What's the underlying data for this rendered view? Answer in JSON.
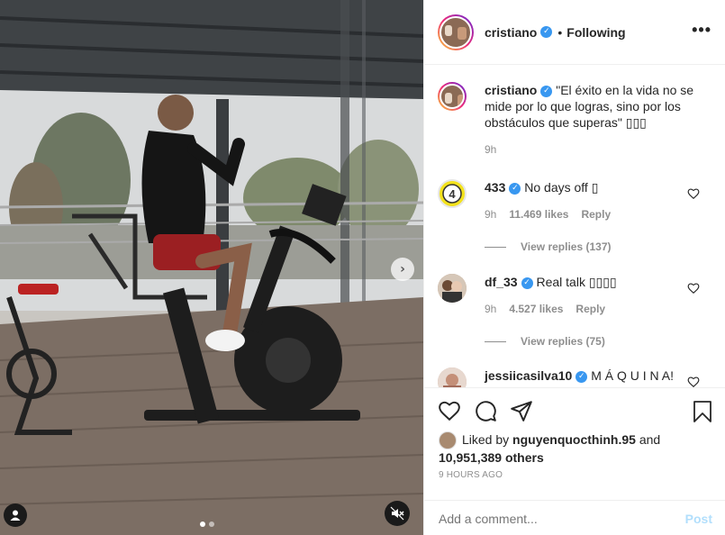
{
  "post": {
    "username": "cristiano",
    "follow_state": "Following",
    "separator": "•",
    "more_icon": "more-horizontal-icon"
  },
  "caption": {
    "username": "cristiano",
    "text": "\"El éxito en la vida no se mide por lo que logras, sino por los obstáculos que superas\" ▯▯▯",
    "time": "9h"
  },
  "comments": [
    {
      "username": "433",
      "text": "No days off ▯",
      "time": "9h",
      "likes": "11.469 likes",
      "reply": "Reply",
      "view_replies": "View replies (137)"
    },
    {
      "username": "df_33",
      "text": "Real talk ▯▯▯▯",
      "time": "9h",
      "likes": "4.527 likes",
      "reply": "Reply",
      "view_replies": "View replies (75)"
    },
    {
      "username": "jessiicasilva10",
      "text": "M Á Q U I N A!"
    }
  ],
  "actions": {
    "liked_by_prefix": "Liked by",
    "liked_by_user": "nguyenquocthinh.95",
    "and": "and",
    "others": "10,951,389 others",
    "time_ago": "9 HOURS AGO"
  },
  "comment_box": {
    "placeholder": "Add a comment...",
    "post_label": "Post"
  },
  "colors": {
    "verified": "#3897f0",
    "post_disabled": "#b2dffc",
    "muted_text": "#8e8e8e"
  },
  "carousel": {
    "current": 1,
    "total": 2
  }
}
